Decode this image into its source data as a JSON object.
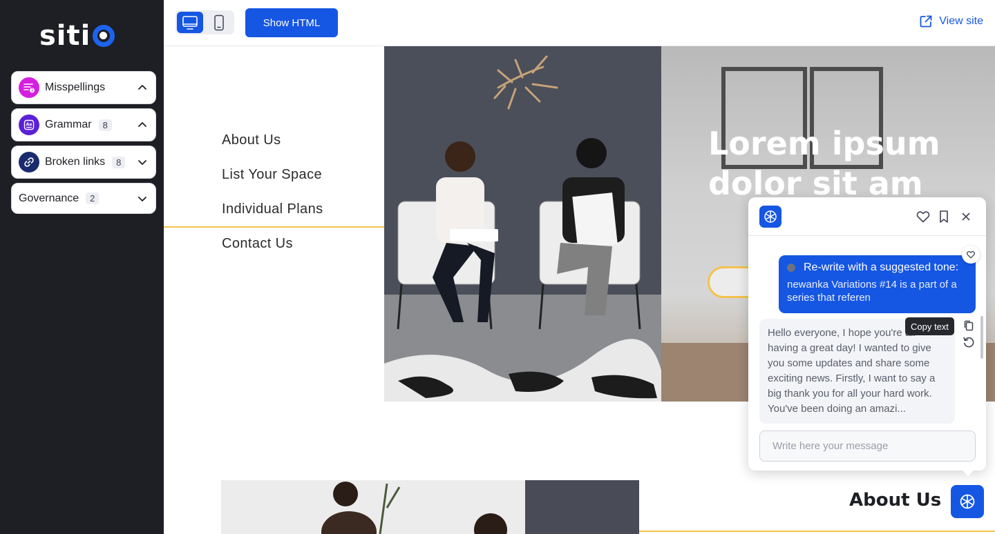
{
  "app": {
    "logo_text": "siti"
  },
  "sidebar": {
    "items": [
      {
        "label": "Misspellings",
        "count": "",
        "icon": "misspellings-icon",
        "color": "#d51fe0",
        "expanded": true
      },
      {
        "label": "Grammar",
        "count": "8",
        "icon": "grammar-icon",
        "color": "#5b21d6",
        "expanded": true
      },
      {
        "label": "Broken links",
        "count": "8",
        "icon": "link-icon",
        "color": "#1a2b6d",
        "expanded": false
      },
      {
        "label": "Governance",
        "count": "2",
        "icon": "",
        "color": "",
        "expanded": false
      }
    ]
  },
  "toolbar": {
    "show_html_label": "Show HTML",
    "view_site_label": "View site",
    "device_active": "desktop"
  },
  "site": {
    "nav": [
      "About Us",
      "List Your Space",
      "Individual Plans",
      "Contact Us"
    ],
    "hero_title": "Lorem ipsum dolor sit am",
    "section_title": "About Us"
  },
  "chat": {
    "user_message_title": "Re-write with a suggested tone:",
    "user_message_body": "newanka Variations #14 is a part of a series that referen",
    "bot_message": "Hello everyone, I hope you're all having a great day! I wanted to give you some updates and share some exciting news. Firstly, I want to say a big thank you for all your hard work. You've been doing an amazi...",
    "tooltip": "Copy text",
    "input_placeholder": "Write here your message"
  },
  "colors": {
    "accent": "#1556e3",
    "highlight": "#f4c24a",
    "sidebar_bg": "#1e1f24"
  }
}
